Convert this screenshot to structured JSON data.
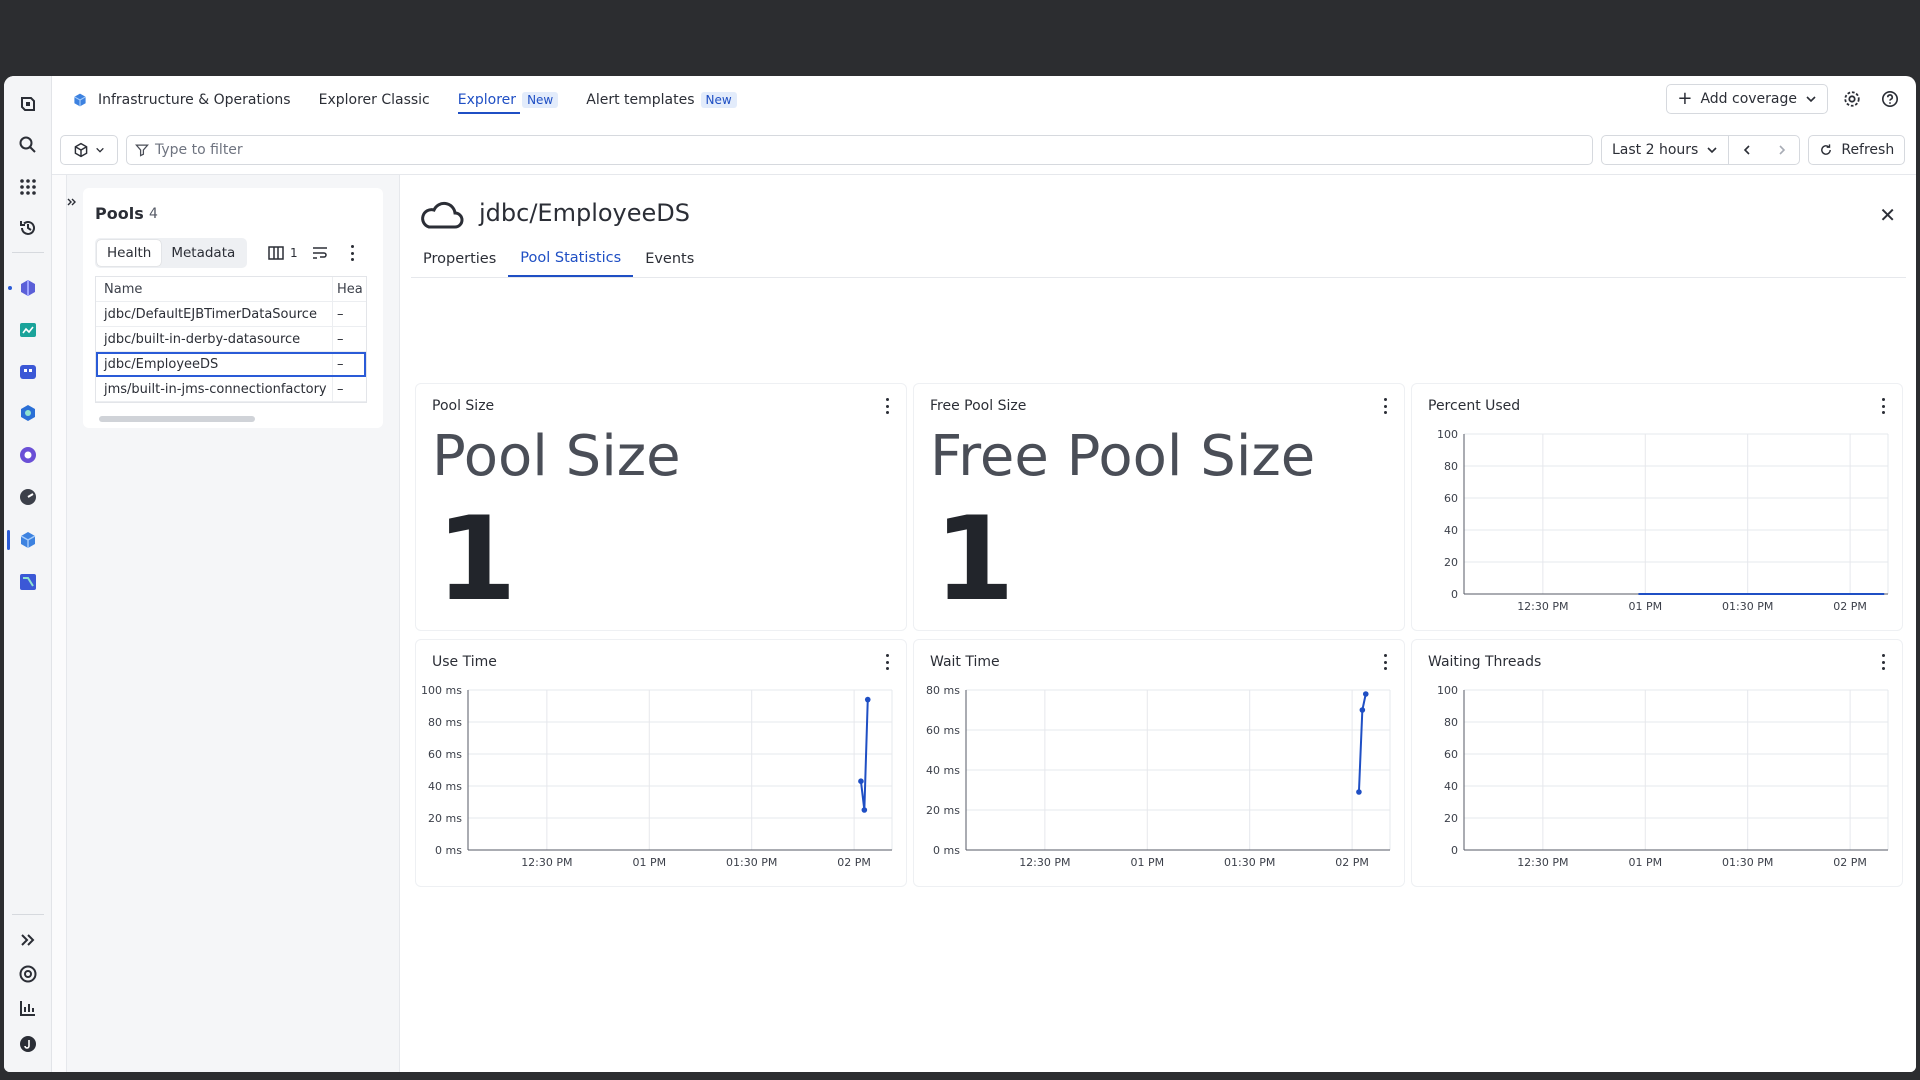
{
  "topnav": {
    "app_title": "Infrastructure & Operations",
    "items": [
      {
        "label": "Explorer Classic",
        "badge": ""
      },
      {
        "label": "Explorer",
        "badge": "New"
      },
      {
        "label": "Alert templates",
        "badge": "New"
      }
    ],
    "add_coverage": "Add coverage"
  },
  "filter": {
    "placeholder": "Type to filter",
    "timeframe": "Last 2 hours",
    "refresh": "Refresh"
  },
  "pools": {
    "title": "Pools",
    "count": "4",
    "segments": [
      "Health",
      "Metadata"
    ],
    "columns_count": "1",
    "headers": [
      "Name",
      "Hea"
    ],
    "rows": [
      {
        "name": "jdbc/DefaultEJBTimerDataSource",
        "health": "–"
      },
      {
        "name": "jdbc/built-in-derby-datasource",
        "health": "–"
      },
      {
        "name": "jdbc/EmployeeDS",
        "health": "–"
      },
      {
        "name": "jms/built-in-jms-connectionfactory",
        "health": "–"
      }
    ]
  },
  "detail": {
    "title": "jdbc/EmployeeDS",
    "tabs": [
      "Properties",
      "Pool Statistics",
      "Events"
    ]
  },
  "cards": {
    "pool_size": {
      "title": "Pool Size",
      "label": "Pool Size",
      "value": "1"
    },
    "free_pool_size": {
      "title": "Free Pool Size",
      "label": "Free Pool Size",
      "value": "1"
    }
  },
  "chart_data": [
    {
      "type": "line",
      "title": "Percent Used",
      "x_ticks": [
        "12:30 PM",
        "01 PM",
        "01:30 PM",
        "02 PM"
      ],
      "y_ticks": [
        "100",
        "80",
        "60",
        "40",
        "20",
        "0"
      ],
      "ylim": [
        0,
        100
      ],
      "series": [
        {
          "x": [
            "12:58 PM",
            "02:10 PM"
          ],
          "y": [
            0,
            0
          ]
        }
      ]
    },
    {
      "type": "line",
      "title": "Use Time",
      "x_ticks": [
        "12:30 PM",
        "01 PM",
        "01:30 PM",
        "02 PM"
      ],
      "y_ticks": [
        "100 ms",
        "80 ms",
        "60 ms",
        "40 ms",
        "20 ms",
        "0 ms"
      ],
      "ylim": [
        0,
        100
      ],
      "series": [
        {
          "x": [
            "02:02 PM",
            "02:03 PM",
            "02:04 PM"
          ],
          "y": [
            43,
            25,
            94
          ]
        }
      ]
    },
    {
      "type": "line",
      "title": "Wait Time",
      "x_ticks": [
        "12:30 PM",
        "01 PM",
        "01:30 PM",
        "02 PM"
      ],
      "y_ticks": [
        "80 ms",
        "60 ms",
        "40 ms",
        "20 ms",
        "0 ms"
      ],
      "ylim": [
        0,
        80
      ],
      "series": [
        {
          "x": [
            "02:02 PM",
            "02:03 PM",
            "02:04 PM"
          ],
          "y": [
            29,
            70,
            78
          ]
        }
      ]
    },
    {
      "type": "line",
      "title": "Waiting Threads",
      "x_ticks": [
        "12:30 PM",
        "01 PM",
        "01:30 PM",
        "02 PM"
      ],
      "y_ticks": [
        "100",
        "80",
        "60",
        "40",
        "20",
        "0"
      ],
      "ylim": [
        0,
        100
      ],
      "series": []
    }
  ]
}
